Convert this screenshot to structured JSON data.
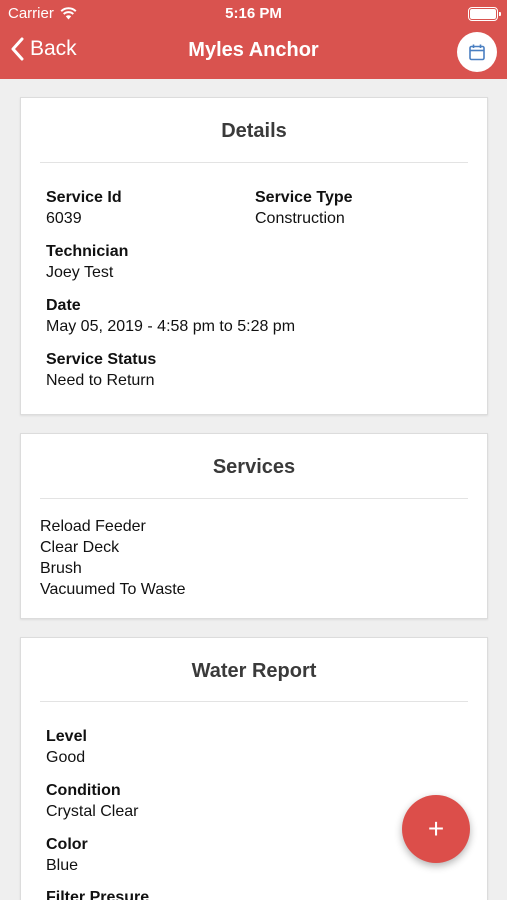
{
  "status_bar": {
    "carrier": "Carrier",
    "time": "5:16 PM"
  },
  "header": {
    "back_label": "Back",
    "title": "Myles Anchor",
    "accent": "#d9534f"
  },
  "details": {
    "title": "Details",
    "service_id_label": "Service Id",
    "service_id": "6039",
    "service_type_label": "Service Type",
    "service_type": "Construction",
    "technician_label": "Technician",
    "technician": "Joey Test",
    "date_label": "Date",
    "date": "May 05, 2019 - 4:58 pm to 5:28 pm",
    "status_label": "Service Status",
    "status": "Need to Return"
  },
  "services": {
    "title": "Services",
    "items": [
      "Reload Feeder",
      "Clear Deck",
      "Brush",
      "Vacuumed To Waste"
    ]
  },
  "water_report": {
    "title": "Water Report",
    "level_label": "Level",
    "level": "Good",
    "condition_label": "Condition",
    "condition": "Crystal Clear",
    "color_label": "Color",
    "color": "Blue",
    "filter_label": "Filter Presure"
  },
  "fab": {
    "label": "+"
  }
}
